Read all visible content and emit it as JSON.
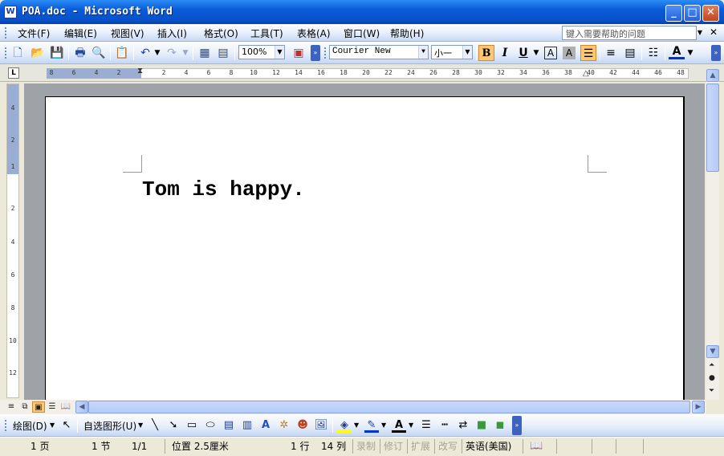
{
  "window": {
    "title": "POA.doc - Microsoft Word",
    "icon_letter": "W"
  },
  "window_controls": {
    "minimize": "_",
    "maximize": "□",
    "close": "✕"
  },
  "menu": {
    "items": [
      "文件(F)",
      "编辑(E)",
      "视图(V)",
      "插入(I)",
      "格式(O)",
      "工具(T)",
      "表格(A)",
      "窗口(W)",
      "帮助(H)"
    ],
    "help_placeholder": "键入需要帮助的问题",
    "close_doc": "✕"
  },
  "toolbar": {
    "zoom": "100%",
    "font_name": "Courier New",
    "font_size": "小一",
    "bold": "B",
    "italic": "I",
    "underline": "U",
    "char_border": "A",
    "char_shading": "A",
    "font_color": "A"
  },
  "ruler": {
    "corner": "L",
    "numbers": [
      "8",
      "6",
      "4",
      "2",
      "2",
      "4",
      "6",
      "8",
      "10",
      "12",
      "14",
      "16",
      "18",
      "20",
      "22",
      "24",
      "26",
      "28",
      "30",
      "32",
      "34",
      "36",
      "38",
      "40",
      "42",
      "44",
      "46",
      "48"
    ],
    "vnumbers": [
      "4",
      "2",
      "1",
      "2",
      "4",
      "6",
      "8",
      "10",
      "12"
    ]
  },
  "document": {
    "text": "Tom is happy."
  },
  "drawing_toolbar": {
    "draw": "绘图(D)",
    "autoshapes": "自选图形(U)"
  },
  "status": {
    "page": "1 页",
    "section": "1 节",
    "page_of": "1/1",
    "position": "位置 2.5厘米",
    "line": "1 行",
    "column": "14 列",
    "rec": "录制",
    "trk": "修订",
    "ext": "扩展",
    "ovr": "改写",
    "language": "英语(美国)"
  },
  "colors": {
    "title_bar": "#0a5bd8",
    "bold_active": "#fcc876",
    "doc_background": "#9fa3a8"
  }
}
